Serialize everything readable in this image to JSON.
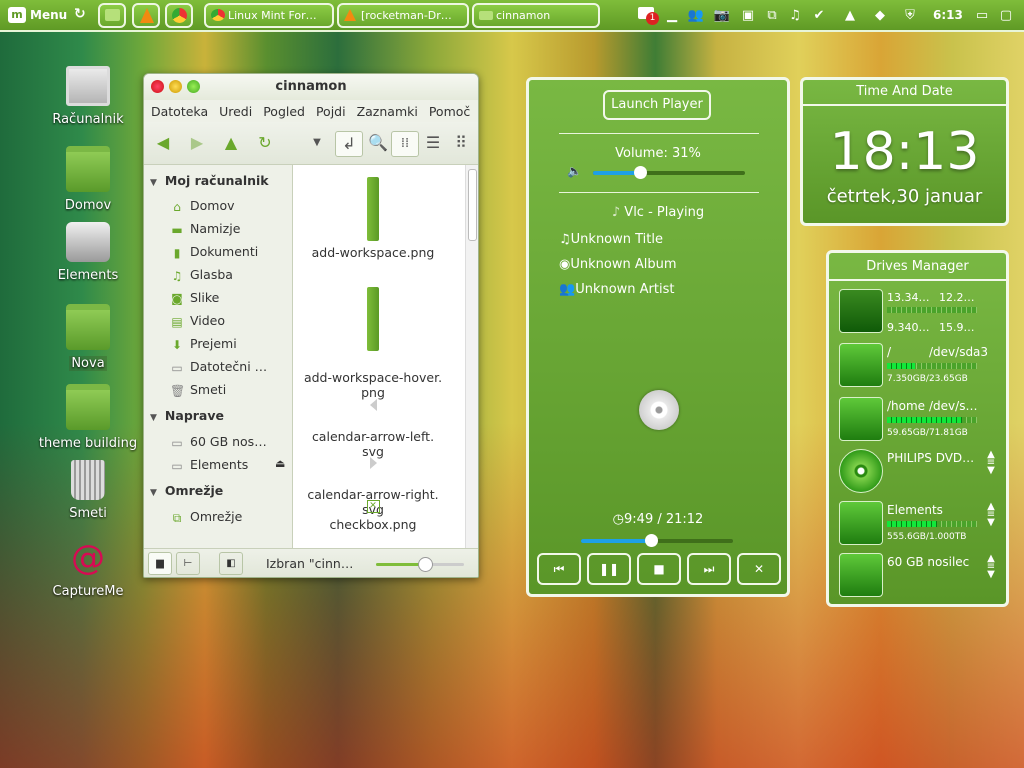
{
  "panel": {
    "menu_label": "Menu",
    "tasks": [
      {
        "label": "Linux Mint For…",
        "icon": "chrome-icon"
      },
      {
        "label": "[rocketman-Dr…",
        "icon": "vlc-icon"
      },
      {
        "label": "cinnamon",
        "icon": "folder-icon"
      }
    ],
    "gmail_badge": "1",
    "clock": "6:13"
  },
  "desktop": {
    "icons": [
      {
        "label": "Računalnik",
        "icon": "computer-icon"
      },
      {
        "label": "Domov",
        "icon": "home-folder-icon"
      },
      {
        "label": "Elements",
        "icon": "hard-drive-icon"
      },
      {
        "label": "Nova",
        "icon": "folder-icon"
      },
      {
        "label": "theme building",
        "icon": "folder-icon"
      },
      {
        "label": "Smeti",
        "icon": "trash-icon"
      },
      {
        "label": "CaptureMe",
        "icon": "debian-icon"
      }
    ]
  },
  "file_manager": {
    "title": "cinnamon",
    "menu": [
      "Datoteka",
      "Uredi",
      "Pogled",
      "Pojdi",
      "Zaznamki",
      "Pomoč"
    ],
    "sidebar": {
      "sections": [
        {
          "title": "Moj računalnik",
          "items": [
            "Domov",
            "Namizje",
            "Dokumenti",
            "Glasba",
            "Slike",
            "Video",
            "Prejemi",
            "Datotečni …",
            "Smeti"
          ]
        },
        {
          "title": "Naprave",
          "items": [
            "60 GB nos…",
            "Elements"
          ]
        },
        {
          "title": "Omrežje",
          "items": [
            "Omrežje"
          ]
        }
      ]
    },
    "files": [
      {
        "name": "add-workspace.png"
      },
      {
        "name": "add-workspace-hover.\npng"
      },
      {
        "name": "calendar-arrow-left.\nsvg"
      },
      {
        "name": "calendar-arrow-right.\nsvg"
      },
      {
        "name": "checkbox.png"
      }
    ],
    "status_text": "Izbran \"cinn…",
    "zoom_level": 0.55
  },
  "player": {
    "launch_label": "Launch Player",
    "volume_label": "Volume: 31%",
    "volume": 0.31,
    "status": "Vlc - Playing",
    "title": "Unknown Title",
    "album": "Unknown Album",
    "artist": "Unknown Artist",
    "time": "9:49 / 21:12",
    "progress": 0.463
  },
  "time_and_date": {
    "header": "Time And Date",
    "time": "18:13",
    "date": "četrtek,30 januar"
  },
  "drives_manager": {
    "header": "Drives Manager",
    "drives": [
      {
        "l1a": "13.34…",
        "l1b": "12.2…",
        "l2a": "9.340…",
        "l2b": "15.9…",
        "type": "network"
      },
      {
        "name": "/",
        "device": "/dev/sda3",
        "usage": "7.350GB/23.65GB",
        "fill": 0.31
      },
      {
        "name": "/home",
        "device": "/dev/s…",
        "usage": "59.65GB/71.81GB",
        "fill": 0.83
      },
      {
        "name": "PHILIPS DVD…",
        "type": "dvd"
      },
      {
        "name": "Elements",
        "usage": "555.6GB/1.000TB",
        "fill": 0.56
      },
      {
        "name": "60 GB nosilec",
        "type": "usb"
      }
    ]
  },
  "colors": {
    "accent": "#6aa82c",
    "panel": "#7fbd3a",
    "progress": "#1ea0e6"
  }
}
